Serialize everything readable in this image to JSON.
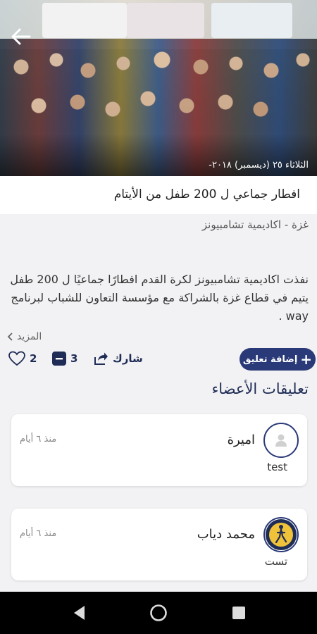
{
  "post": {
    "date": "-الثلاثاء ٢٥ (ديسمبر) ٢٠١٨",
    "title": "افطار جماعي ل 200 طفل من الأيتام",
    "source": "غزة - اكاديمية تشامبيونز",
    "body": "نفذت اكاديمية تشامبيونز لكرة القدم افطارًا جماعيًا ل 200 طفل يتيم في قطاع غزة بالشراكة مع مؤسسة التعاون للشباب لبرنامج way .",
    "more_label": "المزيد"
  },
  "actions": {
    "likes_count": "2",
    "comments_count": "3",
    "share_label": "شارك",
    "add_comment_label": "إضافة تعليق"
  },
  "comments_section": {
    "title": "تعليقات الأعضاء",
    "items": [
      {
        "name": "اميرة",
        "time": "منذ ٦ أيام",
        "text": "test",
        "avatar": "user-placeholder-icon"
      },
      {
        "name": "محمد دياب",
        "time": "منذ ٦ أيام",
        "text": "تست",
        "avatar": "club-logo"
      }
    ]
  },
  "colors": {
    "accent": "#2a3a78",
    "text_dark": "#1f2c55",
    "background": "#f2f2f4"
  }
}
